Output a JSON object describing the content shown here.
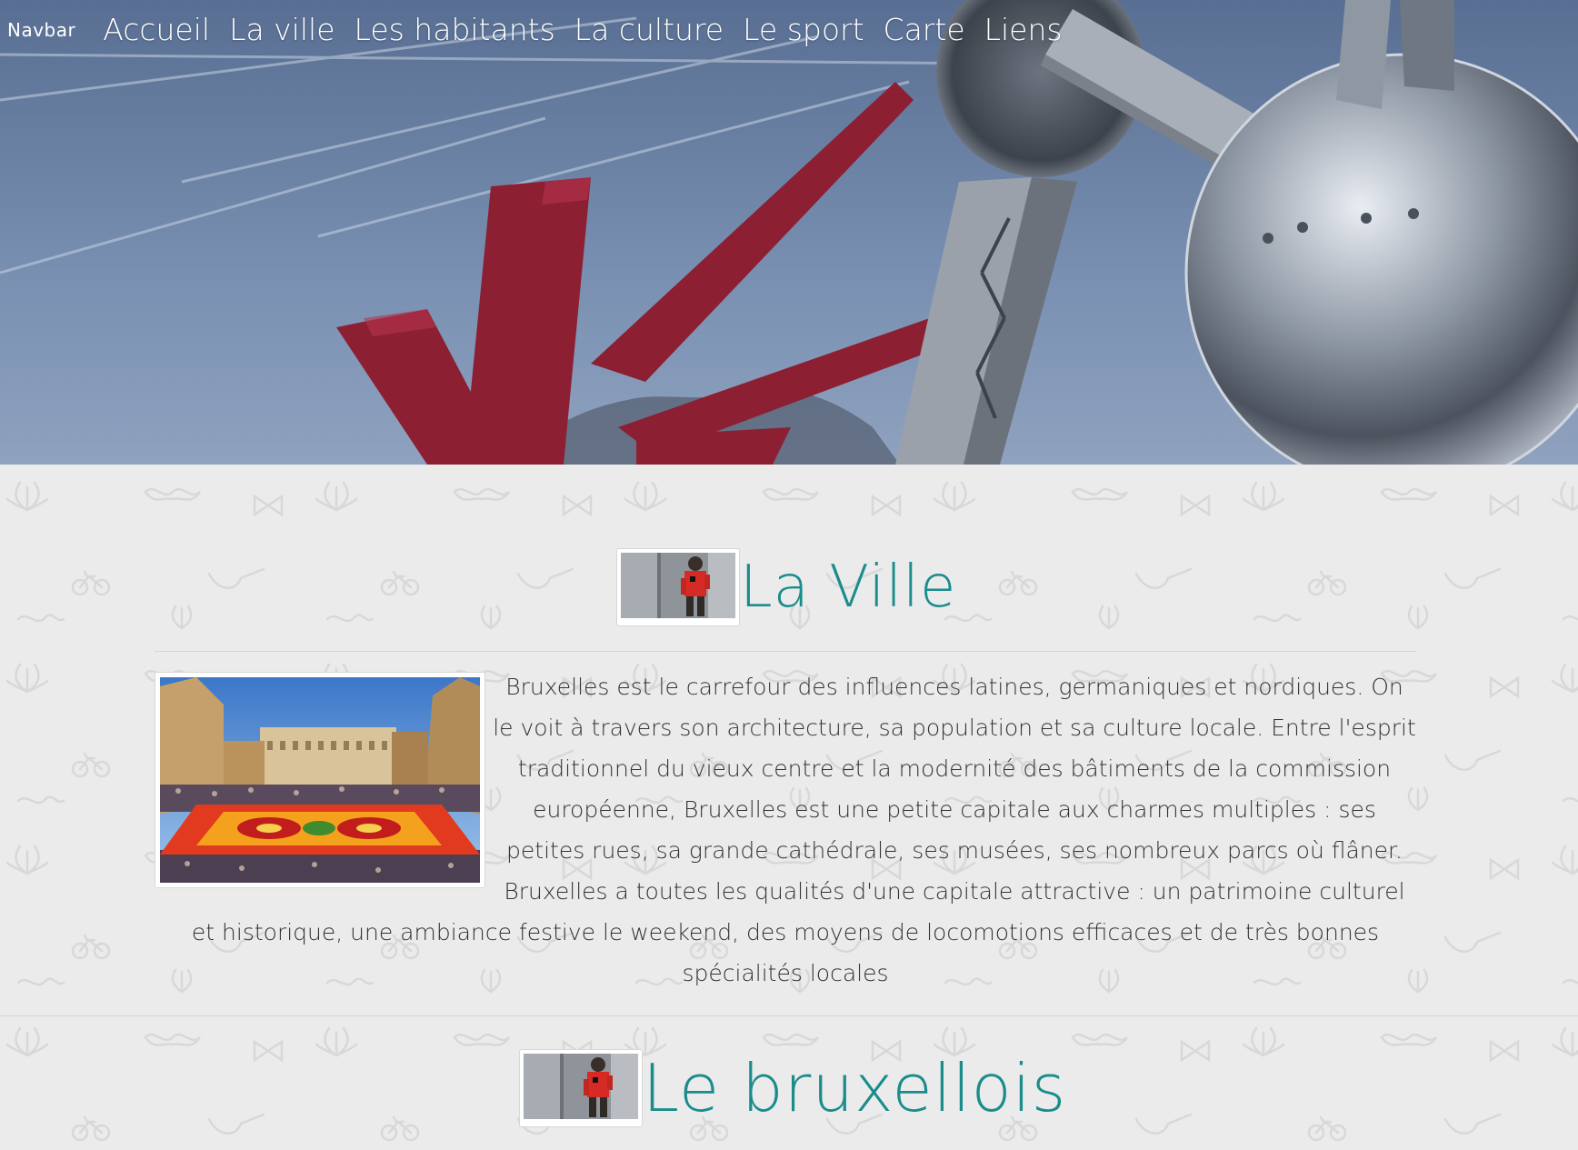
{
  "navbar": {
    "brand": "Navbar",
    "items": [
      "Accueil",
      "La ville",
      "Les habitants",
      "La culture",
      "Le sport",
      "Carte",
      "Liens"
    ]
  },
  "sections": {
    "ville": {
      "title": "La Ville",
      "text": "Bruxelles est le carrefour des influences latines, germaniques et nordiques. On le voit à travers son architecture, sa population et sa culture locale. Entre l'esprit traditionnel du vieux centre et la modernité des bâtiments de la commission européenne, Bruxelles est une petite capitale aux charmes multiples : ses petites rues, sa grande cathédrale, ses musées, ses nombreux parcs où flâner. Bruxelles a toutes les qualités d'une capitale attractive : un patrimoine culturel et historique, une ambiance festive le weekend, des moyens de locomotions efficaces et de très bonnes spécialités locales"
    },
    "bruxellois": {
      "title": "Le bruxellois"
    }
  },
  "colors": {
    "title": "#1a8c8c",
    "background": "#ebebeb",
    "nav_text": "#ffffff"
  }
}
